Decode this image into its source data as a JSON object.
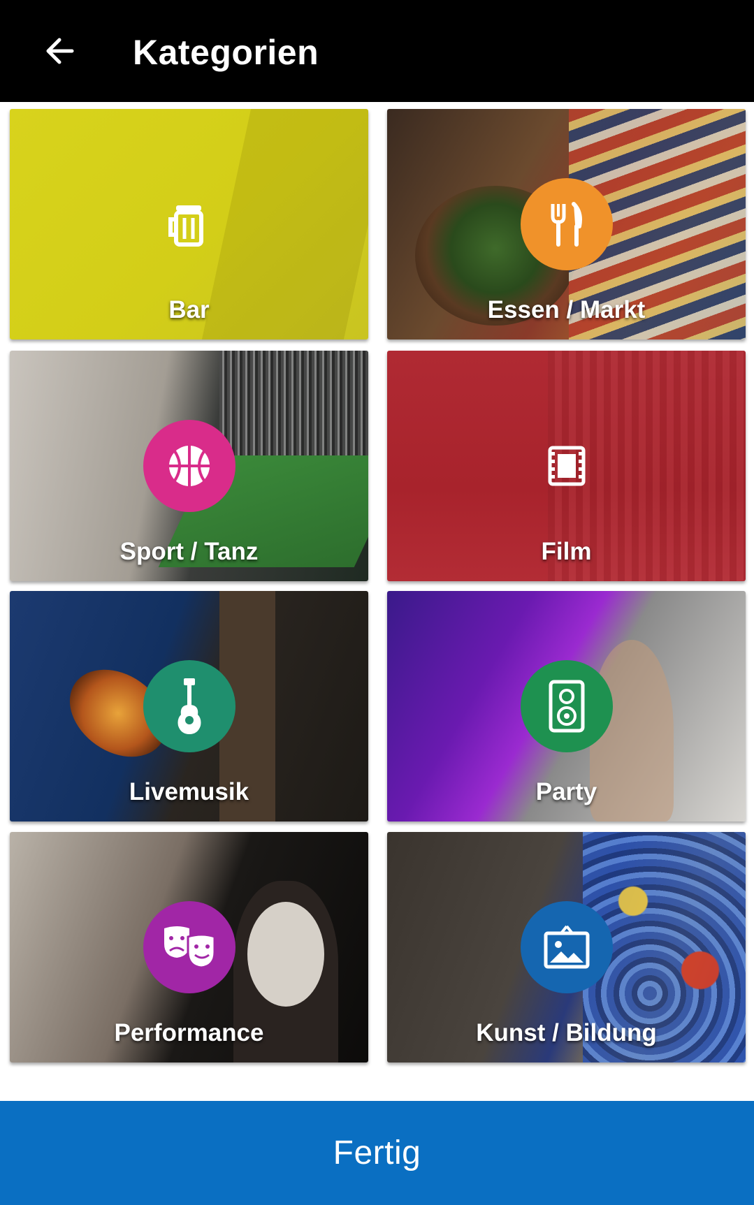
{
  "header": {
    "title": "Kategorien",
    "back_icon": "arrow-left-icon"
  },
  "categories": [
    {
      "label": "Bar",
      "icon": "beer-mug-icon",
      "color": "#d6d11c"
    },
    {
      "label": "Essen / Markt",
      "icon": "fork-knife-icon",
      "color": "#f0922a"
    },
    {
      "label": "Sport / Tanz",
      "icon": "basketball-icon",
      "color": "#d92c8a"
    },
    {
      "label": "Film",
      "icon": "film-strip-icon",
      "color": "#ab2630"
    },
    {
      "label": "Livemusik",
      "icon": "guitar-icon",
      "color": "#1f8f6e"
    },
    {
      "label": "Party",
      "icon": "speaker-icon",
      "color": "#1e9150"
    },
    {
      "label": "Performance",
      "icon": "theater-masks-icon",
      "color": "#a126a6"
    },
    {
      "label": "Kunst / Bildung",
      "icon": "picture-frame-icon",
      "color": "#1566b0"
    }
  ],
  "footer": {
    "done_label": "Fertig",
    "color": "#0a6fc2"
  }
}
